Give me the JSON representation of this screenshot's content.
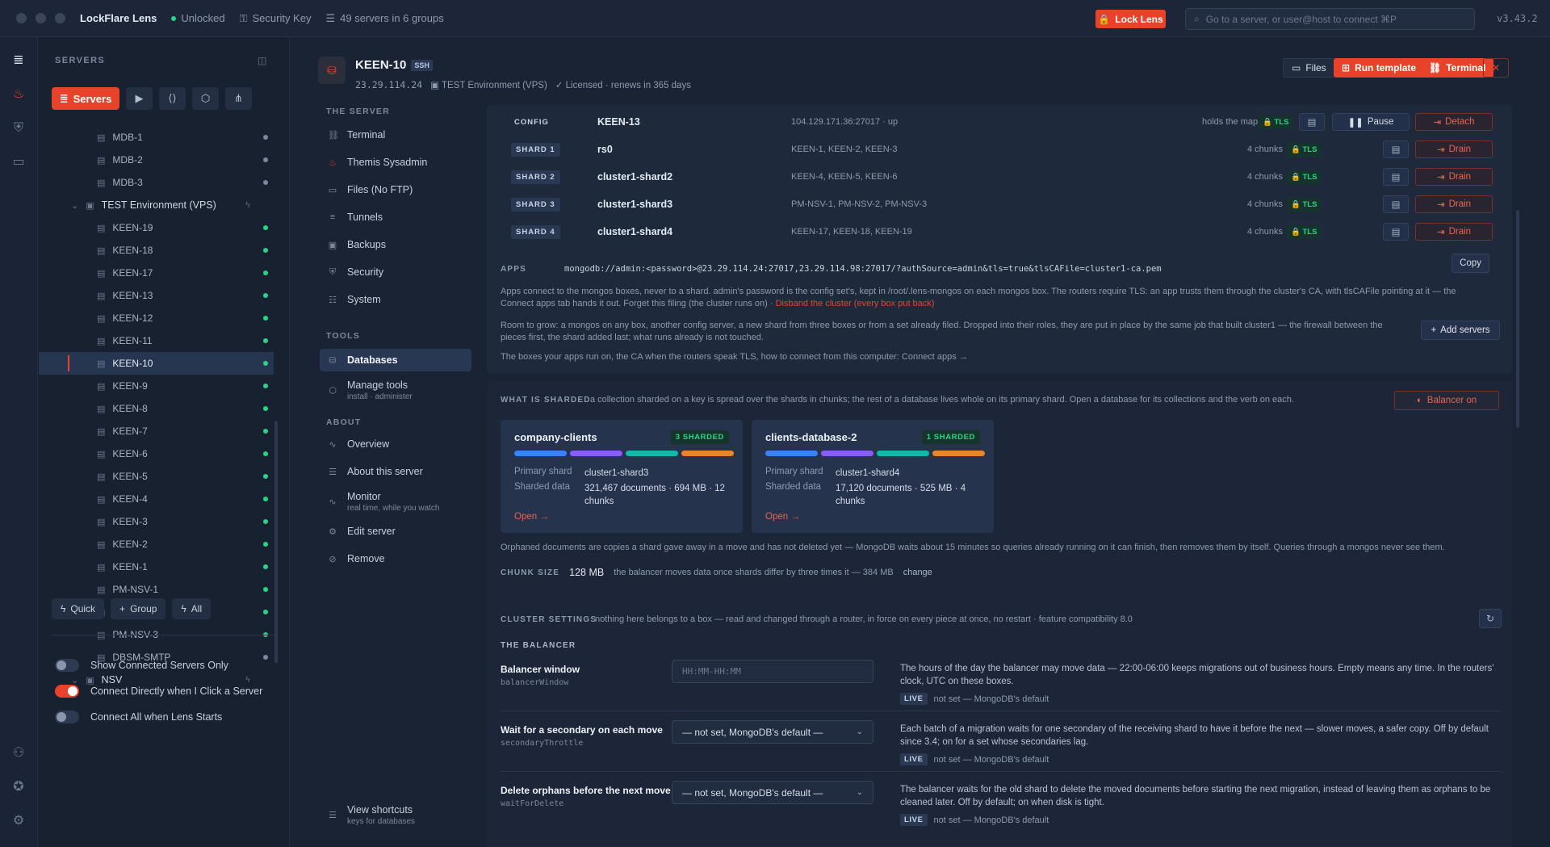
{
  "topbar": {
    "app_title": "LockFlare Lens",
    "lock_state": "Unlocked",
    "security_key": "Security Key",
    "servers_count": "49 servers in 6 groups",
    "lock_button": "Lock Lens",
    "search_placeholder": "Go to a server, or user@host to connect  ⌘P",
    "version": "v3.43.2"
  },
  "sidebar": {
    "heading": "SERVERS",
    "tab_servers": "Servers",
    "tree": [
      {
        "label": "MDB-1",
        "type": "server",
        "status": "idle"
      },
      {
        "label": "MDB-2",
        "type": "server",
        "status": "idle"
      },
      {
        "label": "MDB-3",
        "type": "server",
        "status": "idle"
      },
      {
        "label": "TEST Environment (VPS)",
        "type": "group"
      },
      {
        "label": "KEEN-19",
        "type": "server",
        "status": "up"
      },
      {
        "label": "KEEN-18",
        "type": "server",
        "status": "up"
      },
      {
        "label": "KEEN-17",
        "type": "server",
        "status": "up"
      },
      {
        "label": "KEEN-13",
        "type": "server",
        "status": "up"
      },
      {
        "label": "KEEN-12",
        "type": "server",
        "status": "up"
      },
      {
        "label": "KEEN-11",
        "type": "server",
        "status": "up"
      },
      {
        "label": "KEEN-10",
        "type": "server",
        "status": "up",
        "active": true
      },
      {
        "label": "KEEN-9",
        "type": "server",
        "status": "up"
      },
      {
        "label": "KEEN-8",
        "type": "server",
        "status": "up"
      },
      {
        "label": "KEEN-7",
        "type": "server",
        "status": "up"
      },
      {
        "label": "KEEN-6",
        "type": "server",
        "status": "up"
      },
      {
        "label": "KEEN-5",
        "type": "server",
        "status": "up"
      },
      {
        "label": "KEEN-4",
        "type": "server",
        "status": "up"
      },
      {
        "label": "KEEN-3",
        "type": "server",
        "status": "up"
      },
      {
        "label": "KEEN-2",
        "type": "server",
        "status": "up"
      },
      {
        "label": "KEEN-1",
        "type": "server",
        "status": "up"
      },
      {
        "label": "PM-NSV-1",
        "type": "server",
        "status": "up"
      },
      {
        "label": "PM-NSV-2",
        "type": "server",
        "status": "up"
      },
      {
        "label": "PM-NSV-3",
        "type": "server",
        "status": "up"
      },
      {
        "label": "DBSM-SMTP",
        "type": "server",
        "status": "idle"
      },
      {
        "label": "NSV",
        "type": "group"
      }
    ],
    "actions": {
      "quick": "Quick",
      "group": "Group",
      "all": "All"
    },
    "toggles": [
      {
        "label": "Show Connected Servers Only",
        "on": false
      },
      {
        "label": "Connect Directly when I Click a Server",
        "on": true
      },
      {
        "label": "Connect All when Lens Starts",
        "on": false
      }
    ]
  },
  "header": {
    "server_name": "KEEN-10",
    "protocol": "SSH",
    "ip": "23.29.114.24",
    "group": "TEST Environment (VPS)",
    "license": "Licensed · renews in 365 days",
    "btn_files": "Files",
    "btn_run_template": "Run template",
    "btn_terminal": "Terminal"
  },
  "nav": {
    "the_server": "THE SERVER",
    "tools": "TOOLS",
    "about": "ABOUT",
    "server_items": [
      "Terminal",
      "Themis Sysadmin",
      "Files (No FTP)",
      "Tunnels",
      "Backups",
      "Security",
      "System"
    ],
    "databases": "Databases",
    "manage_tools": "Manage tools",
    "manage_tools_sub": "install · administer",
    "overview": "Overview",
    "about_server": "About this server",
    "monitor": "Monitor",
    "monitor_sub": "real time, while you watch",
    "edit_server": "Edit server",
    "remove": "Remove",
    "shortcuts": "View shortcuts",
    "shortcuts_sub": "keys for databases"
  },
  "shards": {
    "rows": [
      {
        "kind": "CONFIG",
        "name": "KEEN-13",
        "members": "104.129.171.36:27017 · up",
        "chunks": "holds the map",
        "tls": "TLS",
        "action": "Detach",
        "pause": "Pause"
      },
      {
        "kind": "SHARD 1",
        "name": "rs0",
        "members": "KEEN-1, KEEN-2, KEEN-3",
        "chunks": "4 chunks",
        "tls": "TLS",
        "action": "Drain"
      },
      {
        "kind": "SHARD 2",
        "name": "cluster1-shard2",
        "members": "KEEN-4, KEEN-5, KEEN-6",
        "chunks": "4 chunks",
        "tls": "TLS",
        "action": "Drain"
      },
      {
        "kind": "SHARD 3",
        "name": "cluster1-shard3",
        "members": "PM-NSV-1, PM-NSV-2, PM-NSV-3",
        "chunks": "4 chunks",
        "tls": "TLS",
        "action": "Drain"
      },
      {
        "kind": "SHARD 4",
        "name": "cluster1-shard4",
        "members": "KEEN-17, KEEN-18, KEEN-19",
        "chunks": "4 chunks",
        "tls": "TLS",
        "action": "Drain"
      }
    ],
    "apps_label": "APPS",
    "connection_string": "mongodb://admin:<password>@23.29.114.24:27017,23.29.114.98:27017/?authSource=admin&tls=true&tlsCAFile=cluster1-ca.pem",
    "copy": "Copy",
    "apps_note": "Apps connect to the mongos boxes, never to a shard. admin's password is the config set's, kept in /root/.lens-mongos on each mongos box. The routers require TLS: an app trusts them through the cluster's CA, with tlsCAFile pointing at it — the",
    "apps_note2": "Connect apps tab hands it out. Forget this filing (the cluster runs on) · ",
    "disband": "Disband the cluster (every box put back)",
    "room_note": "Room to grow: a mongos on any box, another config server, a new shard from three boxes or from a set already filed. Dropped into their roles, they are put in place by the same job that built cluster1 — the firewall between the",
    "room_note2": "pieces first, the shard added last; what runs already is not touched.",
    "add_servers": "Add servers",
    "connect_note": "The boxes your apps run on, the CA when the routers speak TLS, how to connect from this computer: Connect apps →"
  },
  "sharded": {
    "label": "WHAT IS SHARDED",
    "desc": "a collection sharded on a key is spread over the shards in chunks; the rest of a database lives whole on its primary shard. Open a database for its collections and the verb on each.",
    "balancer": "Balancer on",
    "collections": [
      {
        "name": "company-clients",
        "badge": "3 SHARDED",
        "primary_k": "Primary shard",
        "primary": "cluster1-shard3",
        "data_k": "Sharded data",
        "data": "321,467 documents · 694 MB · 12 chunks",
        "open": "Open →"
      },
      {
        "name": "clients-database-2",
        "badge": "1 SHARDED",
        "primary_k": "Primary shard",
        "primary": "cluster1-shard4",
        "data_k": "Sharded data",
        "data": "17,120 documents · 525 MB · 4 chunks",
        "open": "Open →"
      }
    ],
    "orphan_note": "Orphaned documents are copies a shard gave away in a move and has not deleted yet — MongoDB waits about 15 minutes so queries already running on it can finish, then removes them by itself. Queries through a mongos never see them.",
    "chunk_label": "CHUNK SIZE",
    "chunk_value": "128 MB",
    "chunk_note": "the balancer moves data once shards differ by three times it — 384 MB",
    "chunk_change": "change"
  },
  "settings": {
    "label": "CLUSTER SETTINGS",
    "desc": "nothing here belongs to a box — read and changed through a router, in force on every piece at once, no restart · feature compatibility 8.0",
    "balancer_heading": "THE BALANCER",
    "rows": [
      {
        "title": "Balancer window",
        "key": "balancerWindow",
        "placeholder": "HH:MM-HH:MM",
        "desc": "The hours of the day the balancer may move data — 22:00-06:00 keeps migrations out of business hours. Empty means any time. In the routers' clock, UTC on these boxes.",
        "live": "LIVE",
        "live_note": "not set — MongoDB's default"
      },
      {
        "title": "Wait for a secondary on each move",
        "key": "secondaryThrottle",
        "select": "— not set, MongoDB's default —",
        "desc": "Each batch of a migration waits for one secondary of the receiving shard to have it before the next — slower moves, a safer copy. Off by default since 3.4; on for a set whose secondaries lag.",
        "live": "LIVE",
        "live_note": "not set — MongoDB's default"
      },
      {
        "title": "Delete orphans before the next move",
        "key": "waitForDelete",
        "select": "— not set, MongoDB's default —",
        "desc": "The balancer waits for the old shard to delete the moved documents before starting the next migration, instead of leaving them as orphans to be cleaned later. Off by default; on when disk is tight.",
        "live": "LIVE",
        "live_note": "not set — MongoDB's default"
      }
    ]
  },
  "colors": {
    "accent": "#e8432a",
    "green": "#2bd38a",
    "bar_blue": "#3b82f6",
    "bar_purple": "#8b5cf6",
    "bar_teal": "#14b8a6",
    "bar_orange": "#e8862a"
  }
}
